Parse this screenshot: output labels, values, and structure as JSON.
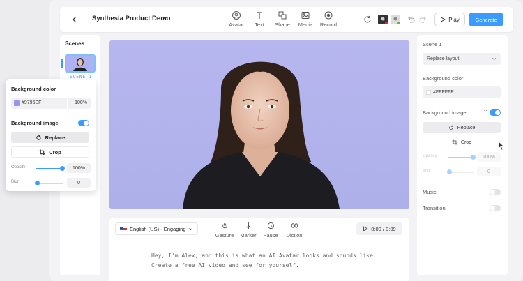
{
  "topbar": {
    "project_title": "Synthesia Product Demo",
    "tools": [
      {
        "label": "Avatar",
        "icon": "avatar-icon"
      },
      {
        "label": "Text",
        "icon": "text-icon"
      },
      {
        "label": "Shape",
        "icon": "shape-icon"
      },
      {
        "label": "Media",
        "icon": "media-icon"
      },
      {
        "label": "Record",
        "icon": "record-icon"
      }
    ],
    "play_label": "Play",
    "generate_label": "Generate"
  },
  "scenes_panel": {
    "title": "Scenes",
    "scene_label": "SCENE 1"
  },
  "popup": {
    "bg_color_title": "Background color",
    "bg_color_hex": "#9796EF",
    "bg_color_opacity": "100%",
    "bg_image_title": "Background image",
    "replace_label": "Replace",
    "crop_label": "Crop",
    "opacity_label": "Opacity",
    "opacity_value": "100%",
    "blur_label": "Blur",
    "blur_value": "0",
    "swatch_color": "#9796EF"
  },
  "bottom": {
    "language": "English (US) - Engaging",
    "tools": [
      {
        "label": "Gesture",
        "icon": "gesture-icon"
      },
      {
        "label": "Marker",
        "icon": "marker-icon"
      },
      {
        "label": "Pause",
        "icon": "pause-icon"
      },
      {
        "label": "Diction",
        "icon": "diction-icon"
      }
    ],
    "time": "0:00 / 0:09",
    "script_line1": "Hey, I'm Alex, and this is what an AI Avatar looks and sounds like.",
    "script_line2": "Create a free AI video and see for yourself."
  },
  "right_panel": {
    "scene_title": "Scene 1",
    "layout_select": "Replace layout",
    "bg_color_title": "Background color",
    "bg_color_hex": "#FFFFFF",
    "bg_image_title": "Background image",
    "replace_label": "Replace",
    "crop_label": "Crop",
    "opacity_label": "Opacity",
    "opacity_value": "100%",
    "blur_label": "Blur",
    "blur_value": "0",
    "music_label": "Music",
    "transition_label": "Transition"
  },
  "colors": {
    "accent": "#3A9CFF",
    "canvas_bg": "#B3B3EC"
  }
}
